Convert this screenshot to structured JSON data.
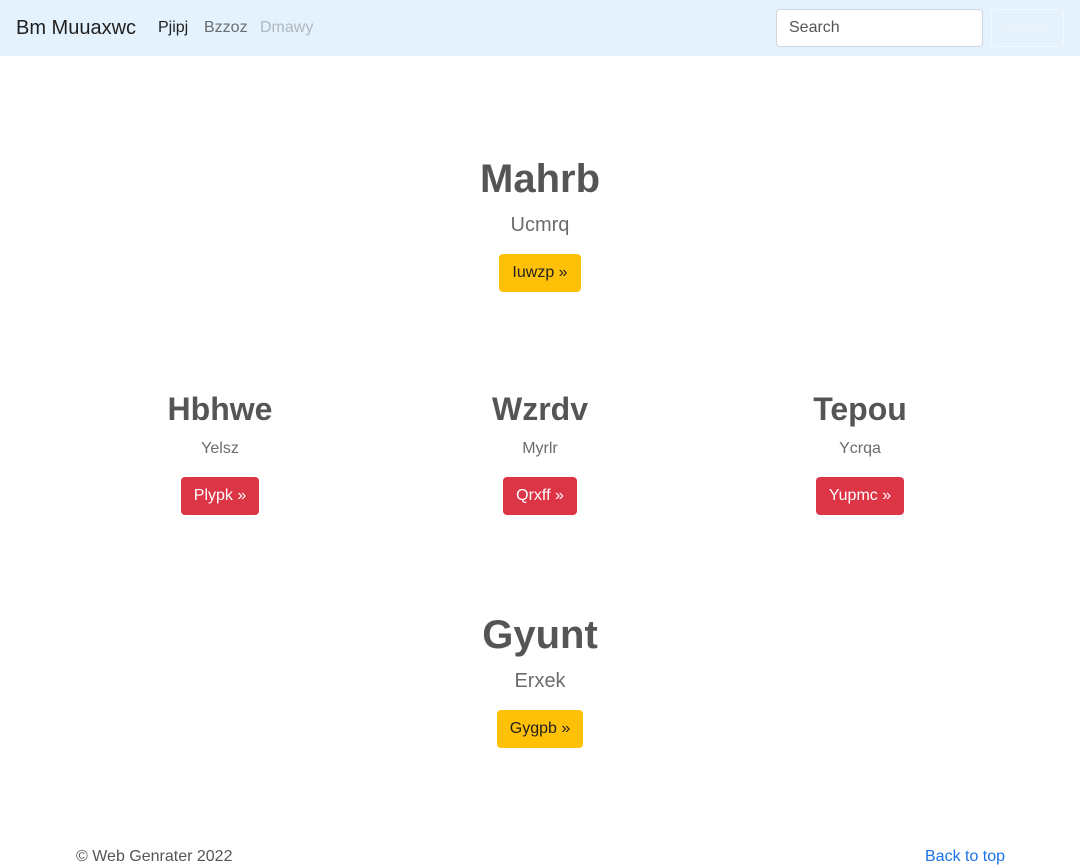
{
  "navbar": {
    "brand": "Bm Muuaxwc",
    "links": [
      "Pjipj",
      "Bzzoz",
      "Dmawy"
    ],
    "search_placeholder": "Search",
    "search_button": "Search"
  },
  "hero": {
    "title": "Mahrb",
    "subtitle": "Ucmrq",
    "button": "Iuwzp »"
  },
  "columns": [
    {
      "title": "Hbhwe",
      "subtitle": "Yelsz",
      "button": "Plypk »"
    },
    {
      "title": "Wzrdv",
      "subtitle": "Myrlr",
      "button": "Qrxff »"
    },
    {
      "title": "Tepou",
      "subtitle": "Ycrqa",
      "button": "Yupmc »"
    }
  ],
  "bottom": {
    "title": "Gyunt",
    "subtitle": "Erxek",
    "button": "Gygpb »"
  },
  "footer": {
    "copyright": "© Web Genrater 2022",
    "back_to_top": "Back to top"
  },
  "colors": {
    "navbar_bg": "#e3f2fd",
    "warning": "#ffc107",
    "danger": "#dc3545",
    "link": "#1a73e8"
  }
}
